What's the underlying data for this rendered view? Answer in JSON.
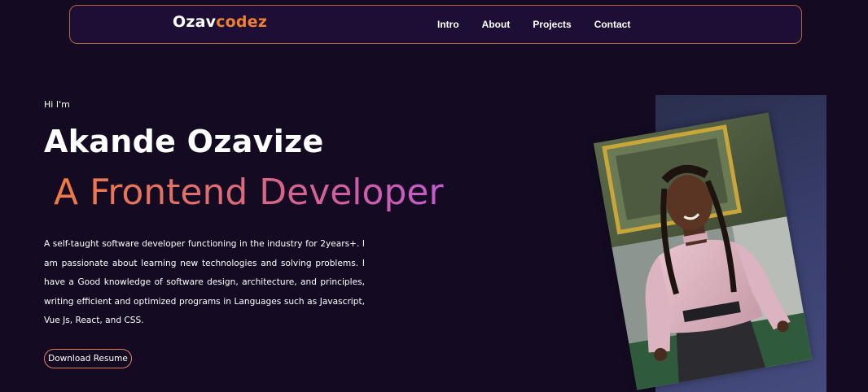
{
  "nav": {
    "logo_part1": "Ozav",
    "logo_part2": "codez",
    "links": [
      "Intro",
      "About",
      "Projects",
      "Contact"
    ]
  },
  "hero": {
    "greeting": "Hi I'm",
    "name": "Akande Ozavize",
    "role": "A Frontend Developer",
    "bio": "A self-taught software developer functioning in the industry for 2years+. I am passionate about learning new technologies and solving problems. I have a Good knowledge of software design, architecture, and principles, writing efficient and optimized programs in Languages such as Javascript, Vue Js, React, and CSS.",
    "resume_button": "Download Resume"
  },
  "colors": {
    "background": "#140b22",
    "navbar_bg": "#1c0e34",
    "accent_orange": "#f08030",
    "gradient_start": "#f07a45",
    "gradient_end": "#c55ccf"
  },
  "photo": {
    "icon": "profile-photo"
  }
}
